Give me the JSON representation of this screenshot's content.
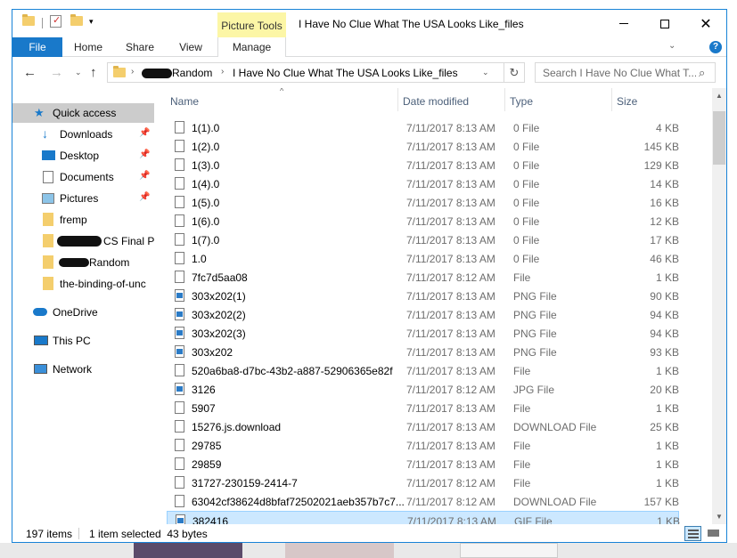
{
  "window": {
    "title": "I Have No Clue What The USA Looks Like_files",
    "context_tab": "Picture Tools"
  },
  "ribbon": {
    "tabs": [
      {
        "label": "File"
      },
      {
        "label": "Home"
      },
      {
        "label": "Share"
      },
      {
        "label": "View"
      },
      {
        "label": "Manage"
      }
    ],
    "help": "?"
  },
  "address": {
    "crumbs": [
      "Random",
      "I Have No Clue What The USA Looks Like_files"
    ]
  },
  "search": {
    "placeholder": "Search I Have No Clue What T..."
  },
  "nav_pane": {
    "items": [
      {
        "label": "Quick access",
        "icon": "star-icon"
      },
      {
        "label": "Downloads",
        "icon": "download-arrow-icon",
        "pinned": true
      },
      {
        "label": "Desktop",
        "icon": "desktop-icon",
        "pinned": true
      },
      {
        "label": "Documents",
        "icon": "documents-icon",
        "pinned": true
      },
      {
        "label": "Pictures",
        "icon": "pictures-icon",
        "pinned": true
      },
      {
        "label": "fremp",
        "icon": "folder-icon"
      },
      {
        "label": "CS Final Pr",
        "icon": "folder-icon"
      },
      {
        "label": "Random",
        "icon": "folder-icon"
      },
      {
        "label": "the-binding-of-unc",
        "icon": "folder-icon"
      },
      {
        "label": "OneDrive",
        "icon": "cloud-icon"
      },
      {
        "label": "This PC",
        "icon": "computer-icon"
      },
      {
        "label": "Network",
        "icon": "network-icon"
      }
    ]
  },
  "columns": {
    "name": "Name",
    "date": "Date modified",
    "type": "Type",
    "size": "Size"
  },
  "files": [
    {
      "name": "1(1).0",
      "date": "7/11/2017 8:13 AM",
      "type": "0 File",
      "size": "4 KB",
      "img": false
    },
    {
      "name": "1(2).0",
      "date": "7/11/2017 8:13 AM",
      "type": "0 File",
      "size": "145 KB",
      "img": false
    },
    {
      "name": "1(3).0",
      "date": "7/11/2017 8:13 AM",
      "type": "0 File",
      "size": "129 KB",
      "img": false
    },
    {
      "name": "1(4).0",
      "date": "7/11/2017 8:13 AM",
      "type": "0 File",
      "size": "14 KB",
      "img": false
    },
    {
      "name": "1(5).0",
      "date": "7/11/2017 8:13 AM",
      "type": "0 File",
      "size": "16 KB",
      "img": false
    },
    {
      "name": "1(6).0",
      "date": "7/11/2017 8:13 AM",
      "type": "0 File",
      "size": "12 KB",
      "img": false
    },
    {
      "name": "1(7).0",
      "date": "7/11/2017 8:13 AM",
      "type": "0 File",
      "size": "17 KB",
      "img": false
    },
    {
      "name": "1.0",
      "date": "7/11/2017 8:13 AM",
      "type": "0 File",
      "size": "46 KB",
      "img": false
    },
    {
      "name": "7fc7d5aa08",
      "date": "7/11/2017 8:12 AM",
      "type": "File",
      "size": "1 KB",
      "img": false
    },
    {
      "name": "303x202(1)",
      "date": "7/11/2017 8:13 AM",
      "type": "PNG File",
      "size": "90 KB",
      "img": true
    },
    {
      "name": "303x202(2)",
      "date": "7/11/2017 8:13 AM",
      "type": "PNG File",
      "size": "94 KB",
      "img": true
    },
    {
      "name": "303x202(3)",
      "date": "7/11/2017 8:13 AM",
      "type": "PNG File",
      "size": "94 KB",
      "img": true
    },
    {
      "name": "303x202",
      "date": "7/11/2017 8:13 AM",
      "type": "PNG File",
      "size": "93 KB",
      "img": true
    },
    {
      "name": "520a6ba8-d7bc-43b2-a887-52906365e82f",
      "date": "7/11/2017 8:13 AM",
      "type": "File",
      "size": "1 KB",
      "img": false
    },
    {
      "name": "3126",
      "date": "7/11/2017 8:12 AM",
      "type": "JPG File",
      "size": "20 KB",
      "img": true
    },
    {
      "name": "5907",
      "date": "7/11/2017 8:13 AM",
      "type": "File",
      "size": "1 KB",
      "img": false
    },
    {
      "name": "15276.js.download",
      "date": "7/11/2017 8:13 AM",
      "type": "DOWNLOAD File",
      "size": "25 KB",
      "img": false
    },
    {
      "name": "29785",
      "date": "7/11/2017 8:13 AM",
      "type": "File",
      "size": "1 KB",
      "img": false
    },
    {
      "name": "29859",
      "date": "7/11/2017 8:13 AM",
      "type": "File",
      "size": "1 KB",
      "img": false
    },
    {
      "name": "31727-230159-2414-7",
      "date": "7/11/2017 8:12 AM",
      "type": "File",
      "size": "1 KB",
      "img": false
    },
    {
      "name": "63042cf38624d8bfaf72502021aeb357b7c7...",
      "date": "7/11/2017 8:12 AM",
      "type": "DOWNLOAD File",
      "size": "157 KB",
      "img": false
    },
    {
      "name": "382416",
      "date": "7/11/2017 8:13 AM",
      "type": "GIF File",
      "size": "1 KB",
      "img": true,
      "selected": true
    }
  ],
  "status": {
    "count": "197 items",
    "selected": "1 item selected  43 bytes"
  },
  "colors": {
    "accent": "#1979ca",
    "selection": "#cce8ff",
    "context_tab": "#fcf6a6",
    "folder": "#f4ce6d"
  }
}
